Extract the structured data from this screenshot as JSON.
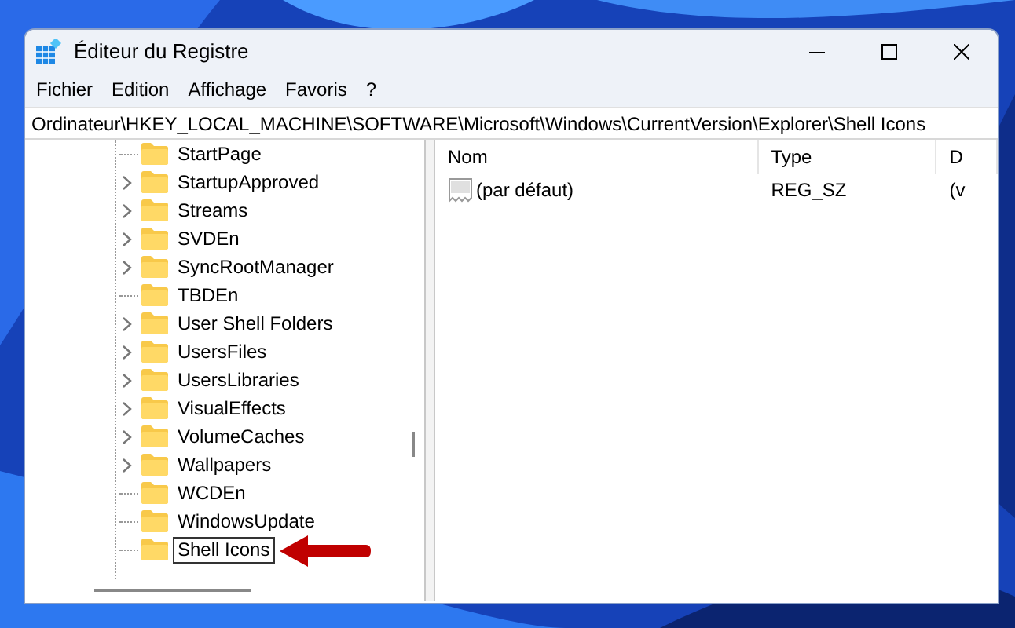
{
  "window": {
    "title": "Éditeur du Registre"
  },
  "menu": [
    "Fichier",
    "Edition",
    "Affichage",
    "Favoris",
    "?"
  ],
  "address": "Ordinateur\\HKEY_LOCAL_MACHINE\\SOFTWARE\\Microsoft\\Windows\\CurrentVersion\\Explorer\\Shell Icons",
  "tree": {
    "items": [
      {
        "label": "StartPage",
        "expandable": false,
        "selected": false
      },
      {
        "label": "StartupApproved",
        "expandable": true,
        "selected": false
      },
      {
        "label": "Streams",
        "expandable": true,
        "selected": false
      },
      {
        "label": "SVDEn",
        "expandable": true,
        "selected": false
      },
      {
        "label": "SyncRootManager",
        "expandable": true,
        "selected": false
      },
      {
        "label": "TBDEn",
        "expandable": false,
        "selected": false
      },
      {
        "label": "User Shell Folders",
        "expandable": true,
        "selected": false
      },
      {
        "label": "UsersFiles",
        "expandable": true,
        "selected": false
      },
      {
        "label": "UsersLibraries",
        "expandable": true,
        "selected": false
      },
      {
        "label": "VisualEffects",
        "expandable": true,
        "selected": false
      },
      {
        "label": "VolumeCaches",
        "expandable": true,
        "selected": false
      },
      {
        "label": "Wallpapers",
        "expandable": true,
        "selected": false
      },
      {
        "label": "WCDEn",
        "expandable": false,
        "selected": false
      },
      {
        "label": "WindowsUpdate",
        "expandable": false,
        "selected": false
      },
      {
        "label": "Shell Icons",
        "expandable": false,
        "selected": true
      }
    ]
  },
  "values": {
    "columns": [
      "Nom",
      "Type",
      "D"
    ],
    "rows": [
      {
        "name": "(par défaut)",
        "type": "REG_SZ",
        "data": "(v"
      }
    ]
  },
  "annotation": {
    "kind": "arrow"
  }
}
